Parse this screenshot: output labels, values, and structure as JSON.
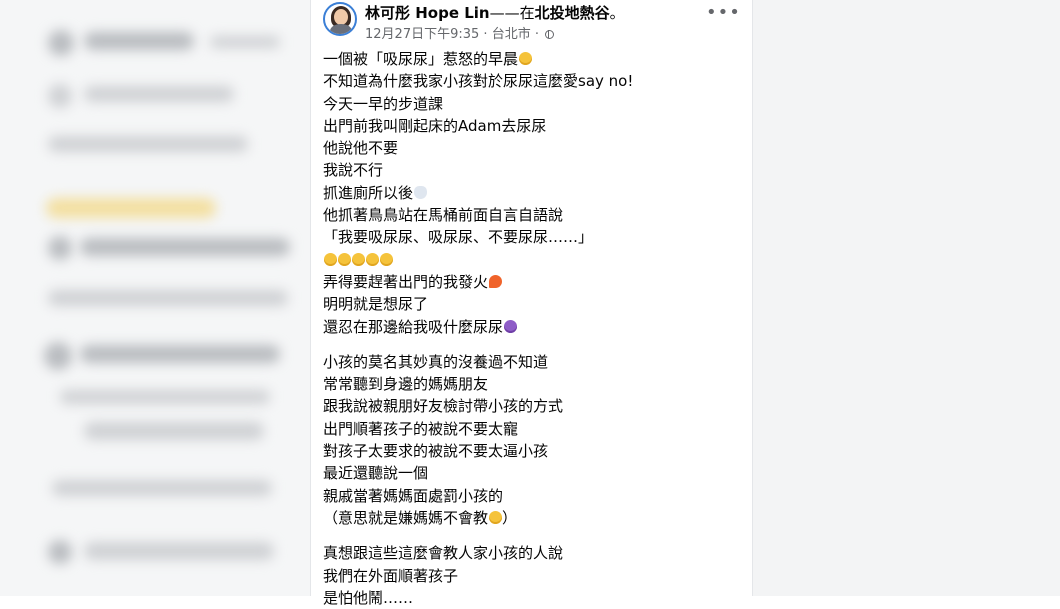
{
  "post": {
    "author_name": "林可彤 Hope Lin",
    "place_connector": "——在",
    "place": "北投地熱谷",
    "place_suffix": "。",
    "timestamp": "12月27日下午9:35",
    "location": "台北市",
    "meta_separator": " · ",
    "more_options": "•••",
    "lines": [
      {
        "text": "一個被「吸尿尿」惹怒的早晨",
        "emoji": "emo-yellow"
      },
      {
        "text": "不知道為什麼我家小孩對於尿尿這麼愛say no!",
        "emoji": ""
      },
      {
        "text": "今天一早的步道課",
        "emoji": ""
      },
      {
        "text": "出門前我叫剛起床的Adam去尿尿",
        "emoji": ""
      },
      {
        "text": "他說他不要",
        "emoji": ""
      },
      {
        "text": "我說不行",
        "emoji": ""
      },
      {
        "text": "抓進廁所以後",
        "emoji": "emo-toilet"
      },
      {
        "text": "他抓著鳥鳥站在馬桶前面自言自語說",
        "emoji": ""
      },
      {
        "text": "「我要吸尿尿、吸尿尿、不要尿尿……」",
        "emoji": ""
      },
      {
        "text": "",
        "emoji": "emo-yellow",
        "repeat": 5
      },
      {
        "text": "弄得要趕著出門的我發火",
        "emoji": "emo-fire"
      },
      {
        "text": "明明就是想尿了",
        "emoji": ""
      },
      {
        "text": "還忍在那邊給我吸什麼尿尿",
        "emoji": "emo-purple"
      }
    ],
    "lines2": [
      {
        "text": "小孩的莫名其妙真的沒養過不知道",
        "emoji": ""
      },
      {
        "text": "常常聽到身邊的媽媽朋友",
        "emoji": ""
      },
      {
        "text": "跟我說被親朋好友檢討帶小孩的方式",
        "emoji": ""
      },
      {
        "text": "出門順著孩子的被說不要太寵",
        "emoji": ""
      },
      {
        "text": "對孩子太要求的被說不要太逼小孩",
        "emoji": ""
      },
      {
        "text": "最近還聽說一個",
        "emoji": ""
      },
      {
        "text": "親戚當著媽媽面處罰小孩的",
        "emoji": ""
      },
      {
        "text": "（意思就是嫌媽媽不會教",
        "emoji": "emo-yellow",
        "suffix": "）"
      }
    ],
    "lines3": [
      {
        "text": "真想跟這些這麼會教人家小孩的人說",
        "emoji": ""
      },
      {
        "text": "我們在外面順著孩子",
        "emoji": ""
      },
      {
        "text": "是怕他鬧……",
        "emoji": ""
      }
    ]
  }
}
